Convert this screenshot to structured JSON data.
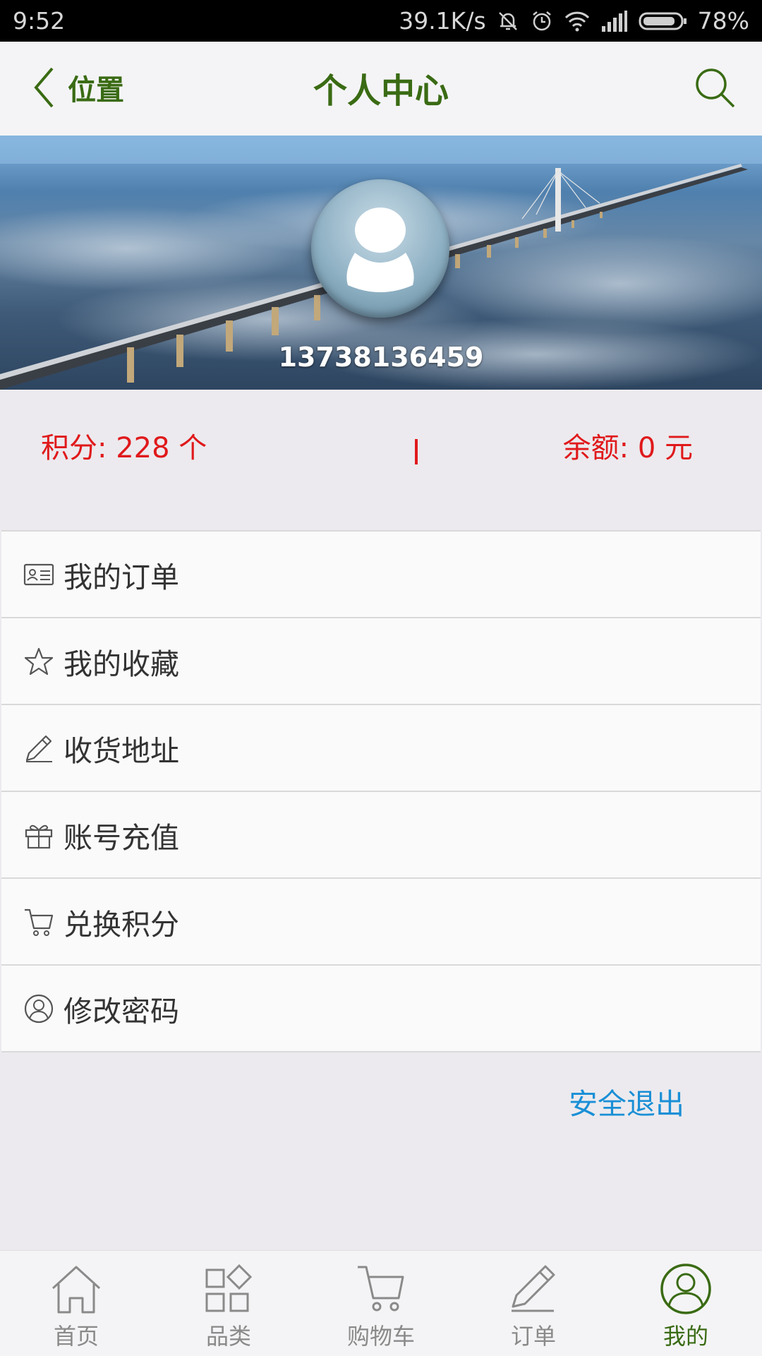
{
  "status_bar": {
    "time": "9:52",
    "network_speed": "39.1K/s",
    "battery": "78%"
  },
  "header": {
    "back_label": "位置",
    "title": "个人中心"
  },
  "profile": {
    "phone": "13738136459"
  },
  "stats": {
    "points": "积分: 228 个",
    "balance": "余额: 0 元"
  },
  "menu": {
    "items": [
      {
        "label": "我的订单",
        "icon": "order-card-icon"
      },
      {
        "label": "我的收藏",
        "icon": "star-icon"
      },
      {
        "label": "收货地址",
        "icon": "pencil-icon"
      },
      {
        "label": "账号充值",
        "icon": "gift-icon"
      },
      {
        "label": "兑换积分",
        "icon": "cart-icon"
      },
      {
        "label": "修改密码",
        "icon": "user-circle-icon"
      }
    ]
  },
  "logout_label": "安全退出",
  "tabbar": {
    "tabs": [
      {
        "label": "首页",
        "icon": "home-icon"
      },
      {
        "label": "品类",
        "icon": "category-icon"
      },
      {
        "label": "购物车",
        "icon": "cart-icon"
      },
      {
        "label": "订单",
        "icon": "pencil-icon"
      },
      {
        "label": "我的",
        "icon": "user-circle-icon"
      }
    ],
    "active": "我的"
  },
  "colors": {
    "brand_green": "#3a6b14",
    "stat_red": "#e0191b",
    "link_blue": "#1a8fd6"
  }
}
